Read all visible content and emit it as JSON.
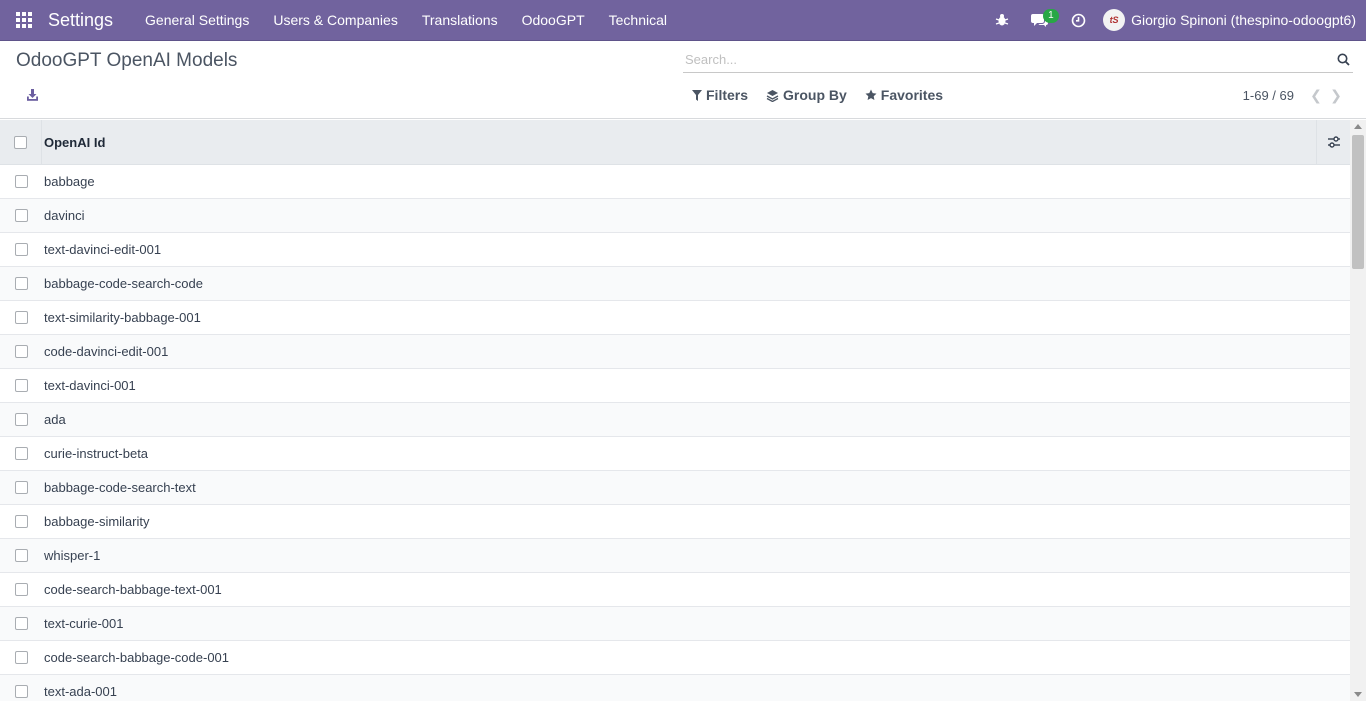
{
  "navbar": {
    "brand": "Settings",
    "menu": [
      "General Settings",
      "Users & Companies",
      "Translations",
      "OdooGPT",
      "Technical"
    ],
    "messages_badge": "1",
    "user_name": "Giorgio Spinoni (thespino-odoogpt6)",
    "avatar_initials": "tS",
    "icons": [
      "apps-grid-icon",
      "bug-icon",
      "chat-icon",
      "clock-icon"
    ]
  },
  "control_panel": {
    "title": "OdooGPT OpenAI Models",
    "search_placeholder": "Search...",
    "filters_label": "Filters",
    "groupby_label": "Group By",
    "favorites_label": "Favorites",
    "pager_value": "1-69 / 69"
  },
  "table": {
    "column_header": "OpenAI Id",
    "rows": [
      "babbage",
      "davinci",
      "text-davinci-edit-001",
      "babbage-code-search-code",
      "text-similarity-babbage-001",
      "code-davinci-edit-001",
      "text-davinci-001",
      "ada",
      "curie-instruct-beta",
      "babbage-code-search-text",
      "babbage-similarity",
      "whisper-1",
      "code-search-babbage-text-001",
      "text-curie-001",
      "code-search-babbage-code-001",
      "text-ada-001"
    ]
  },
  "colors": {
    "navbar_bg": "#71639e",
    "badge_bg": "#28a745"
  }
}
